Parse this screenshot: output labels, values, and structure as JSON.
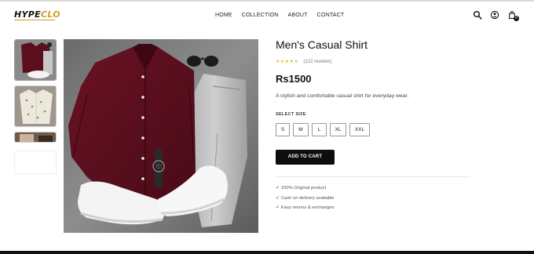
{
  "header": {
    "logo_main": "HYPE",
    "logo_accent": "CLO",
    "nav": [
      "HOME",
      "COLLECTION",
      "ABOUT",
      "CONTACT"
    ],
    "cart_count": "0",
    "icons": [
      "search-icon",
      "user-icon",
      "cart-icon"
    ]
  },
  "product": {
    "title": "Men's Casual Shirt",
    "stars": "★★★★★",
    "reviews": "(122 reviews)",
    "price": "Rs1500",
    "description": "A stylish and comfortable casual shirt for everyday wear.",
    "size_label": "SELECT SIZE",
    "sizes": [
      "S",
      "M",
      "L",
      "XL",
      "XXL"
    ],
    "add_to_cart": "ADD TO CART",
    "perks": [
      "100% Original product",
      "Cash on delivery available",
      "Easy returns & exchanges"
    ],
    "check_glyph": "✓"
  },
  "colors": {
    "accent": "#c9a227",
    "shirt": "#5b0f1e",
    "jeans": "#b9b9b9",
    "button": "#0d0d0d",
    "stars": "#e2c044"
  }
}
